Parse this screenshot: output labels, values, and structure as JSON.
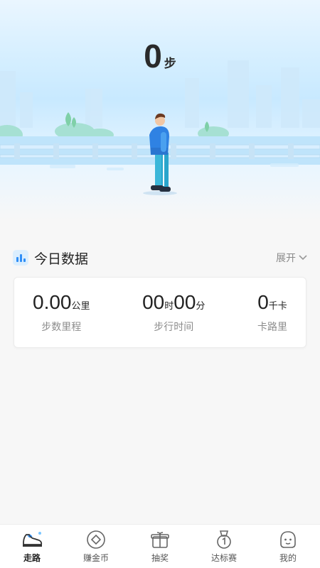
{
  "hero": {
    "steps_value": "0",
    "steps_unit": "步"
  },
  "today": {
    "title": "今日数据",
    "expand_label": "展开",
    "stats": [
      {
        "value": "0.00",
        "unit": "公里",
        "label": "步数里程"
      },
      {
        "hours": "00",
        "hours_unit": "时",
        "minutes": "00",
        "minutes_unit": "分",
        "label": "步行时间"
      },
      {
        "value": "0",
        "unit": "千卡",
        "label": "卡路里"
      }
    ]
  },
  "nav": {
    "items": [
      {
        "label": "走路",
        "icon": "sneaker-icon",
        "active": true
      },
      {
        "label": "赚金币",
        "icon": "coin-icon",
        "active": false
      },
      {
        "label": "抽奖",
        "icon": "gift-box-icon",
        "active": false
      },
      {
        "label": "达标赛",
        "icon": "medal-icon",
        "active": false
      },
      {
        "label": "我的",
        "icon": "face-icon",
        "active": false
      }
    ]
  },
  "colors": {
    "accent": "#2f8ef7",
    "sky": "#c8e9ff",
    "text_primary": "#222222",
    "text_secondary": "#8c8c8c"
  }
}
